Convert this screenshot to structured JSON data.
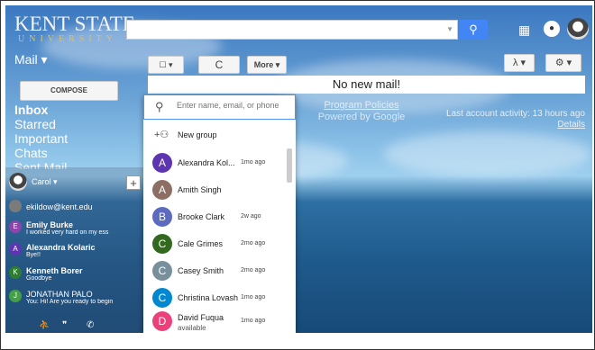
{
  "logo": {
    "line1": "KENT STATE",
    "line2": "UNIVERSITY"
  },
  "header": {
    "search_placeholder": "",
    "apps_icon": "apps-grid-icon",
    "notifications_icon": "bell-icon"
  },
  "mail_label": "Mail ▾",
  "toolbar": {
    "select_label": "☐ ▾",
    "refresh_label": "C",
    "more_label": "More ▾",
    "input_tools_label": "λ ▾",
    "settings_label": "⚙ ▾"
  },
  "compose_label": "COMPOSE",
  "no_mail_text": "No new mail!",
  "folders": [
    "Inbox",
    "Starred",
    "Important",
    "Chats",
    "Sent Mail"
  ],
  "center_footer": {
    "program_policies": "Program Policies",
    "powered_by": "Powered by Google"
  },
  "activity": {
    "text": "Last account activity: 13 hours ago",
    "details": "Details"
  },
  "hangouts": {
    "user_name": "Carol ▾",
    "plus_label": "+",
    "rows": [
      {
        "initial": "",
        "name": "ekildow@kent.edu",
        "sub": "",
        "color": "#7b7b7b"
      },
      {
        "initial": "E",
        "name": "Emily Burke",
        "sub": "I worked very hard on my ess",
        "color": "#8e44ad"
      },
      {
        "initial": "A",
        "name": "Alexandra Kolaric",
        "sub": "Bye!!",
        "color": "#5e35b1"
      },
      {
        "initial": "K",
        "name": "Kenneth Borer",
        "sub": "Goodbye",
        "color": "#2e7d32"
      },
      {
        "initial": "J",
        "name": "JONATHAN PALO",
        "sub": "You: Hi! Are you ready to begin",
        "color": "#43a047"
      }
    ]
  },
  "dropdown": {
    "search_placeholder": "Enter name, email, or phone",
    "new_group_label": "New group",
    "contacts": [
      {
        "initial": "A",
        "name": "Alexandra Kol...",
        "time": "1mo ago",
        "color": "#5e35b1",
        "sub": ""
      },
      {
        "initial": "A",
        "name": "Amith Singh",
        "time": "",
        "color": "#8d6e63",
        "sub": ""
      },
      {
        "initial": "B",
        "name": "Brooke Clark",
        "time": "2w ago",
        "color": "#5c6bc0",
        "sub": ""
      },
      {
        "initial": "C",
        "name": "Cale Grimes",
        "time": "2mo ago",
        "color": "#33691e",
        "sub": ""
      },
      {
        "initial": "C",
        "name": "Casey Smith",
        "time": "2mo ago",
        "color": "#78909c",
        "sub": ""
      },
      {
        "initial": "C",
        "name": "Christina Lovash",
        "time": "1mo ago",
        "color": "#0288d1",
        "sub": ""
      },
      {
        "initial": "D",
        "name": "David Fuqua",
        "time": "1mo ago",
        "color": "#ec407a",
        "sub": "available"
      }
    ]
  }
}
